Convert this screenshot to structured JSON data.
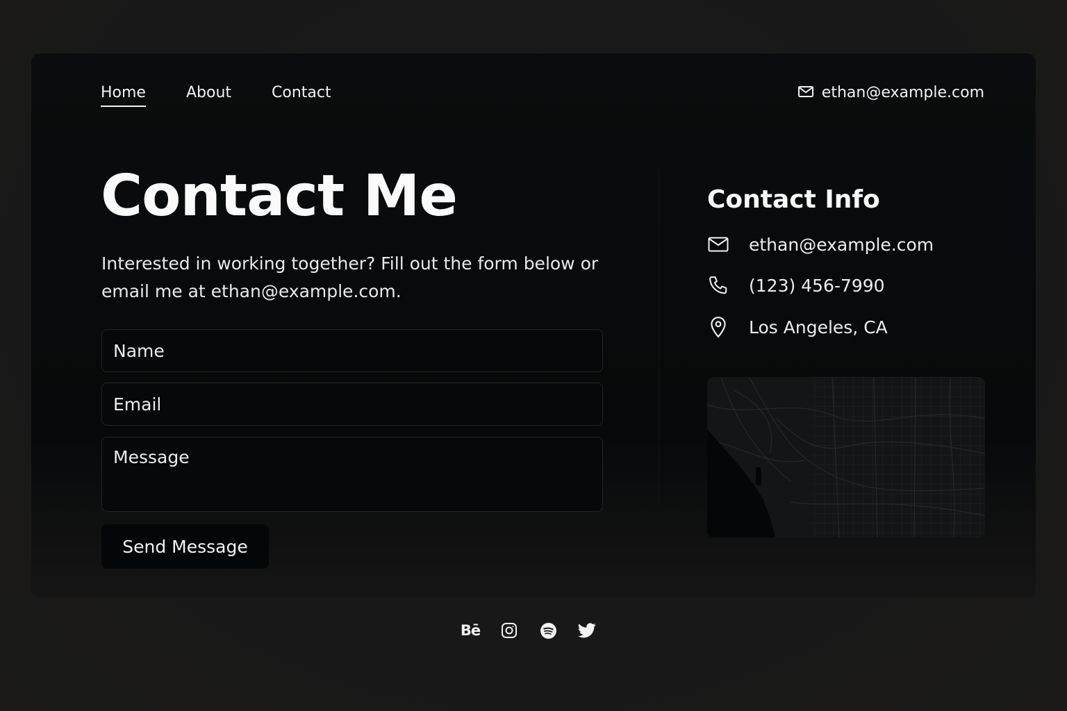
{
  "nav": {
    "items": [
      {
        "label": "Home",
        "active": true
      },
      {
        "label": "About",
        "active": false
      },
      {
        "label": "Contact",
        "active": false
      }
    ],
    "email": "ethan@example.com"
  },
  "main": {
    "title": "Contact Me",
    "intro": "Interested in working together? Fill out the form below or email me at ethan@example.com.",
    "form": {
      "name_placeholder": "Name",
      "email_placeholder": "Email",
      "message_placeholder": "Message",
      "submit_label": "Send Message"
    }
  },
  "contact_info": {
    "title": "Contact Info",
    "email": "ethan@example.com",
    "phone": "(123) 456-7990",
    "location": "Los Angeles, CA"
  },
  "footer": {
    "socials": [
      {
        "icon": "behance-icon",
        "glyph": "Bē"
      },
      {
        "icon": "instagram-icon"
      },
      {
        "icon": "spotify-icon"
      },
      {
        "icon": "twitter-icon"
      }
    ]
  },
  "colors": {
    "background": "#1b1a19",
    "card": "#0a0b0c",
    "text": "#f2f2f2"
  }
}
